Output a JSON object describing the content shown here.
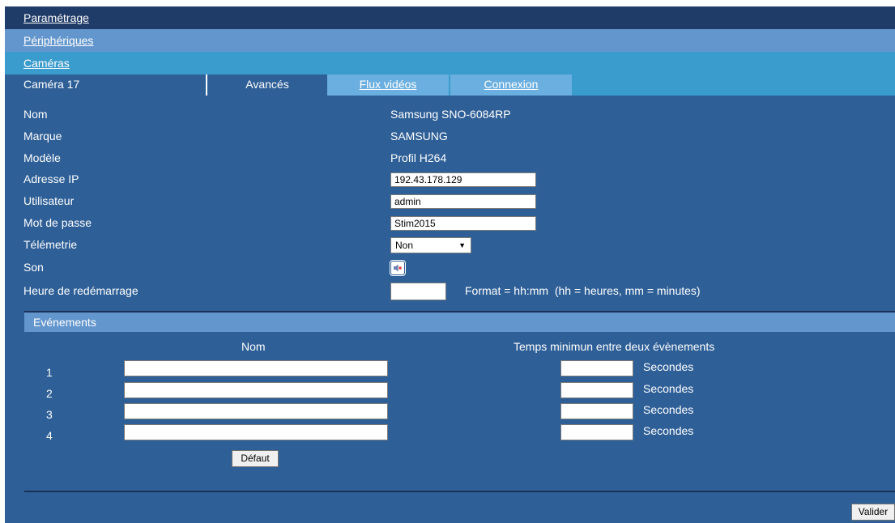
{
  "nav": {
    "parametrage": "Paramétrage",
    "peripheriques": "Périphériques",
    "cameras": "Caméras"
  },
  "tabs": {
    "camera": "Caméra 17",
    "avances": "Avancés",
    "flux": "Flux vidéos",
    "connexion": "Connexion"
  },
  "fields": {
    "nom": {
      "label": "Nom",
      "value": "Samsung SNO-6084RP"
    },
    "marque": {
      "label": "Marque",
      "value": "SAMSUNG"
    },
    "modele": {
      "label": "Modèle",
      "value": "Profil H264"
    },
    "ip": {
      "label": "Adresse IP",
      "value": "192.43.178.129"
    },
    "user": {
      "label": "Utilisateur",
      "value": "admin"
    },
    "password": {
      "label": "Mot de passe",
      "value": "Stim2015"
    },
    "telemetrie": {
      "label": "Télémetrie",
      "value": "Non"
    },
    "son": {
      "label": "Son",
      "icon": "speaker-muted-icon"
    },
    "heure": {
      "label": "Heure de redémarrage",
      "value": "",
      "format": "Format = hh:mm  (hh = heures, mm = minutes)"
    }
  },
  "events": {
    "title": "Evénements",
    "col_nom": "Nom",
    "col_temps": "Temps minimun entre deux évènements",
    "unit": "Secondes",
    "rows": [
      {
        "num": "1",
        "name": "",
        "seconds": ""
      },
      {
        "num": "2",
        "name": "",
        "seconds": ""
      },
      {
        "num": "3",
        "name": "",
        "seconds": ""
      },
      {
        "num": "4",
        "name": "",
        "seconds": ""
      }
    ]
  },
  "buttons": {
    "defaut": "Défaut",
    "valider": "Valider"
  },
  "colors": {
    "background": "#2e5f97",
    "nav_dark": "#1f3b68",
    "nav_mid": "#6396cd",
    "nav_light": "#3a9bcd",
    "tab_inactive": "#6aafe0"
  }
}
